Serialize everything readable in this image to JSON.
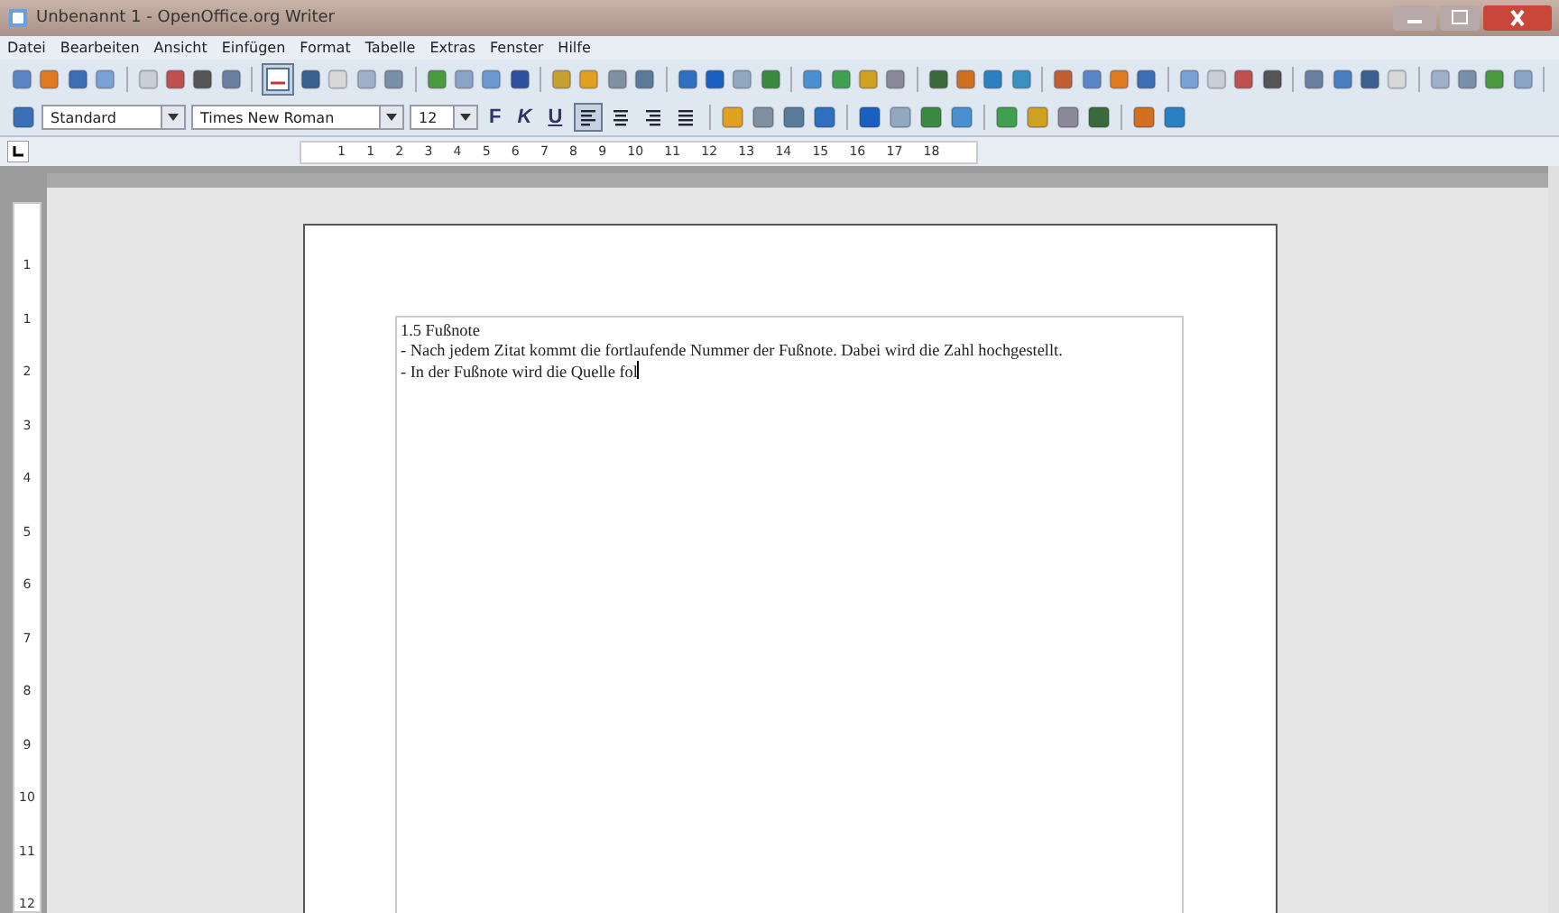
{
  "window": {
    "title": "Unbenannt 1 - OpenOffice.org Writer"
  },
  "menu": [
    "Datei",
    "Bearbeiten",
    "Ansicht",
    "Einfügen",
    "Format",
    "Tabelle",
    "Extras",
    "Fenster",
    "Hilfe"
  ],
  "standard_toolbar": {
    "spellcheck_toggle": {
      "selected": true
    }
  },
  "formatting_toolbar": {
    "style": "Standard",
    "font": "Times New Roman",
    "size": "12",
    "bold": "F",
    "italic": "K",
    "underline": "U",
    "alignments": [
      {
        "selected": true
      },
      {
        "selected": false
      },
      {
        "selected": false
      },
      {
        "selected": false
      }
    ]
  },
  "horizontal_ruler": [
    "1",
    "1",
    "2",
    "3",
    "4",
    "5",
    "6",
    "7",
    "8",
    "9",
    "10",
    "11",
    "12",
    "13",
    "14",
    "15",
    "16",
    "17",
    "18"
  ],
  "vertical_ruler": [
    "1",
    "1",
    "2",
    "3",
    "4",
    "5",
    "6",
    "7",
    "8",
    "9",
    "10",
    "11",
    "12"
  ],
  "document": {
    "paragraphs": [
      "1.5 Fußnote",
      "- Nach jedem Zitat kommt die fortlaufende Nummer der Fußnote. Dabei wird die Zahl hochgestellt.",
      "- In der Fußnote wird die Quelle fol"
    ]
  }
}
